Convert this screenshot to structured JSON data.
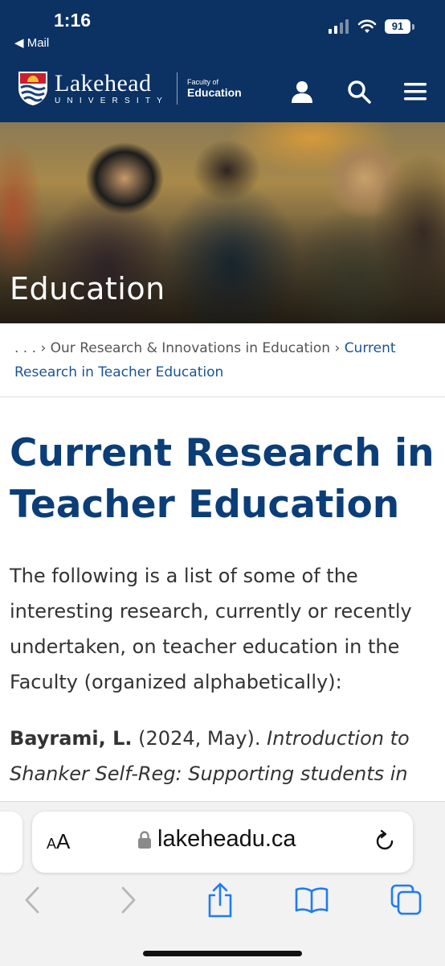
{
  "status_bar": {
    "time": "1:16",
    "back_app": "◀ Mail",
    "battery": "91"
  },
  "header": {
    "brand_name": "Lakehead",
    "brand_sub": "UNIVERSITY",
    "faculty_line1": "Faculty of",
    "faculty_line2": "Education",
    "icons": [
      "user-icon",
      "search-icon",
      "menu-icon"
    ]
  },
  "hero": {
    "title": "Education"
  },
  "breadcrumb": {
    "ellipsis": ". . .",
    "separator": "›",
    "parent": "Our Research & Innovations in Education",
    "current": "Current Research in Teacher Education"
  },
  "content": {
    "title": "Current Research in Teacher Education",
    "intro": "The following is a list of some of the interesting research, currently or recently undertaken, on teacher education in the Faculty (organized alphabetically):",
    "citation_author": "Bayrami, L.",
    "citation_date": " (2024, May). ",
    "citation_title": "Introduction to Shanker Self-Reg: Supporting students in"
  },
  "browser": {
    "aa_small": "A",
    "aa_large": "A",
    "url": "lakeheadu.ca",
    "toolbar": [
      "back-icon",
      "forward-icon",
      "share-icon",
      "bookmarks-icon",
      "tabs-icon"
    ]
  },
  "colors": {
    "navy": "#0b3263",
    "title_blue": "#0b3e78",
    "link_blue": "#1a5394"
  }
}
